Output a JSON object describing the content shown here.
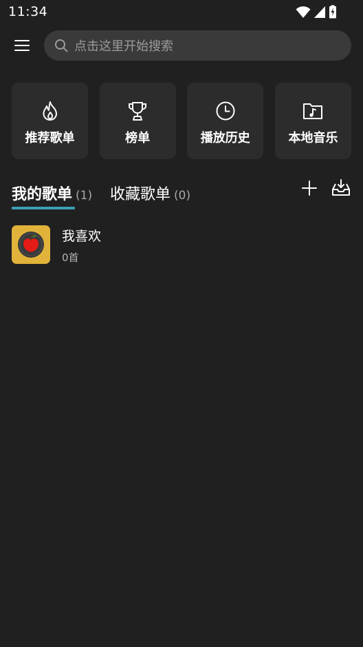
{
  "status_bar": {
    "time": "11:34",
    "icons": [
      "wifi-icon",
      "cell-signal-icon",
      "battery-charging-icon"
    ]
  },
  "header": {
    "menu_icon": "hamburger-menu-icon",
    "search": {
      "icon": "search-icon",
      "placeholder": "点击这里开始搜索"
    }
  },
  "quick_cards": [
    {
      "icon": "flame-icon",
      "label": "推荐歌单"
    },
    {
      "icon": "trophy-icon",
      "label": "榜单"
    },
    {
      "icon": "clock-icon",
      "label": "播放历史"
    },
    {
      "icon": "music-folder-icon",
      "label": "本地音乐"
    }
  ],
  "tabs": [
    {
      "label": "我的歌单",
      "count": "(1)",
      "active": true
    },
    {
      "label": "收藏歌单",
      "count": "(0)",
      "active": false
    }
  ],
  "tab_actions": [
    "plus-icon",
    "inbox-download-icon"
  ],
  "playlists": [
    {
      "title": "我喜欢",
      "count": "0首",
      "cover": "apple-record-cover"
    }
  ],
  "colors": {
    "background": "#202020",
    "card": "#2c2c2c",
    "search_bg": "#3a3a3a",
    "accent": "#3c9fb4",
    "cover_bg": "#e2b33a"
  }
}
